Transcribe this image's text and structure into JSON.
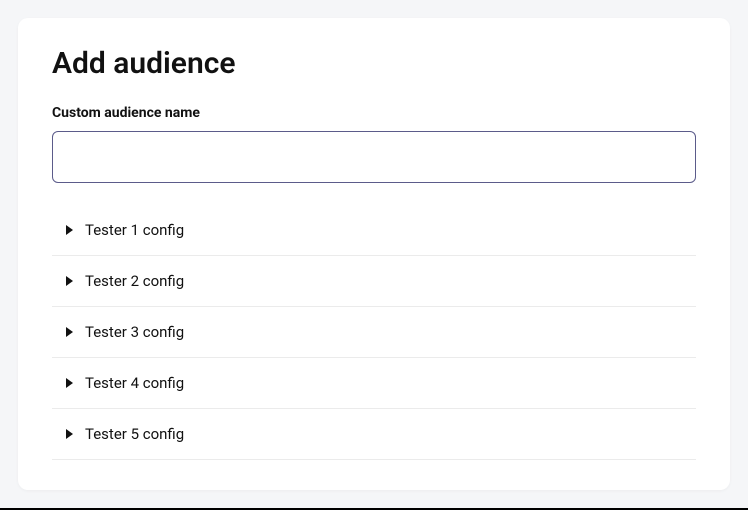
{
  "page": {
    "title": "Add audience"
  },
  "form": {
    "custom_audience": {
      "label": "Custom audience name",
      "value": "",
      "placeholder": ""
    }
  },
  "testers": {
    "items": [
      {
        "label": "Tester 1 config",
        "expanded": false
      },
      {
        "label": "Tester 2 config",
        "expanded": false
      },
      {
        "label": "Tester 3 config",
        "expanded": false
      },
      {
        "label": "Tester 4 config",
        "expanded": false
      },
      {
        "label": "Tester 5 config",
        "expanded": false
      }
    ]
  }
}
